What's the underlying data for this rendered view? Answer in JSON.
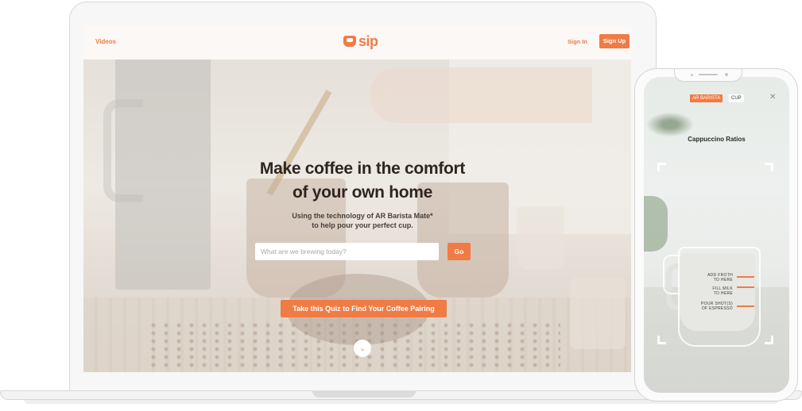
{
  "laptop": {
    "nav": {
      "videos_link": "Videos",
      "logo_text": "sip",
      "sign_in": "Sign In",
      "sign_up": "Sign Up"
    },
    "hero": {
      "title_line1": "Make coffee in the comfort",
      "title_line2": "of your own home",
      "subtitle_line1": "Using the technology of AR Barista Mate*",
      "subtitle_line2": "to help pour your perfect cup.",
      "search_placeholder": "What are we brewing today?",
      "go_button": "Go",
      "quiz_button": "Take this Quiz to Find Your Coffee Pairing",
      "scroll_icon": "chevron-down-icon"
    }
  },
  "phone": {
    "tabs": [
      "AR BARISTA",
      "CUP"
    ],
    "close_icon": "close-icon",
    "title": "Cappuccino Ratios",
    "markers": [
      {
        "line1": "ADD FROTH",
        "line2": "TO HERE"
      },
      {
        "line1": "FILL MILK",
        "line2": "TO HERE"
      },
      {
        "line1": "POUR SHOT(S)",
        "line2": "OF ESPRESSO"
      }
    ]
  },
  "colors": {
    "accent": "#f07b45",
    "text_dark": "#2f2520",
    "nav_bg": "#fbf8f6"
  }
}
